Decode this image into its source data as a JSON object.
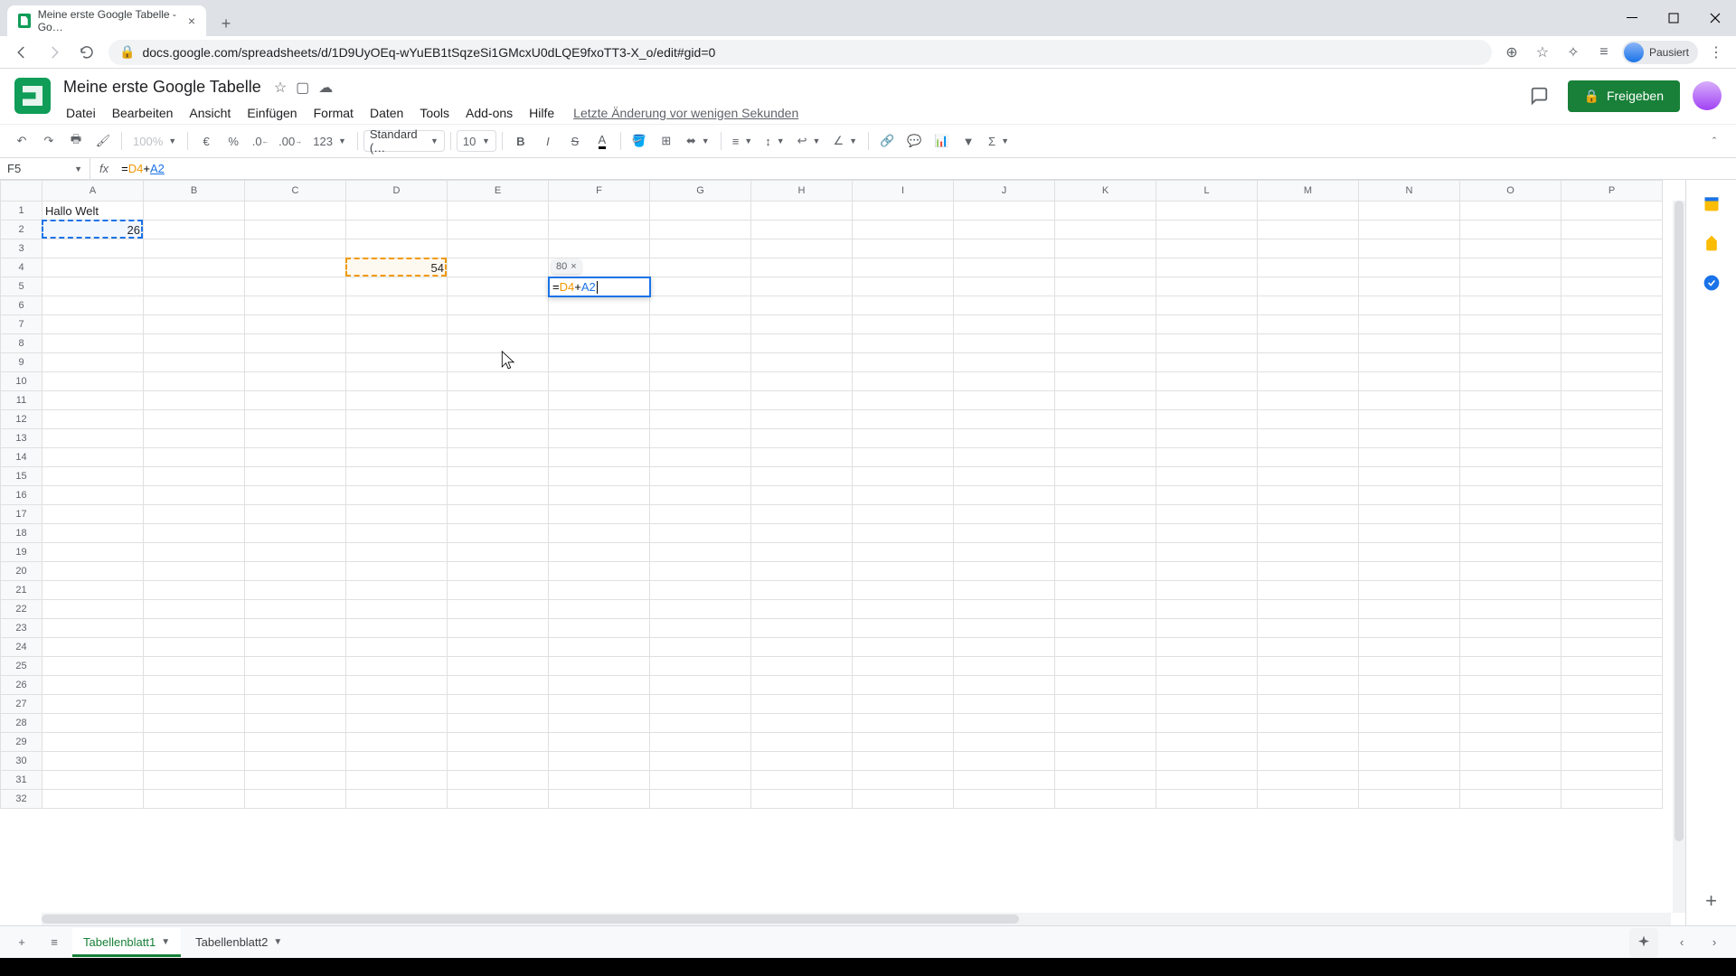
{
  "browser": {
    "tab_title": "Meine erste Google Tabelle - Go…",
    "url": "docs.google.com/spreadsheets/d/1D9UyOEq-wYuEB1tSqzeSi1GMcxU0dLQE9fxoTT3-X_o/edit#gid=0",
    "profile_label": "Pausiert"
  },
  "doc": {
    "title": "Meine erste Google Tabelle",
    "last_edit": "Letzte Änderung vor wenigen Sekunden",
    "share": "Freigeben"
  },
  "menu": [
    "Datei",
    "Bearbeiten",
    "Ansicht",
    "Einfügen",
    "Format",
    "Daten",
    "Tools",
    "Add-ons",
    "Hilfe"
  ],
  "toolbar": {
    "zoom": "100%",
    "currency": "€",
    "percent": "%",
    "dec_less": ".0",
    "dec_more": ".00",
    "num_fmt": "123",
    "font": "Standard (…",
    "size": "10"
  },
  "formula": {
    "cell_ref": "F5",
    "prefix": "=",
    "ref1": "D4",
    "op": "+",
    "ref2": "A2",
    "preview": "80"
  },
  "columns": [
    "A",
    "B",
    "C",
    "D",
    "E",
    "F",
    "G",
    "H",
    "I",
    "J",
    "K",
    "L",
    "M",
    "N",
    "O",
    "P"
  ],
  "cells": {
    "A1": "Hallo Welt",
    "A2": "26",
    "D4": "54",
    "F5_display": "=D4+A2"
  },
  "sheets": {
    "active": "Tabellenblatt1",
    "other": "Tabellenblatt2"
  }
}
